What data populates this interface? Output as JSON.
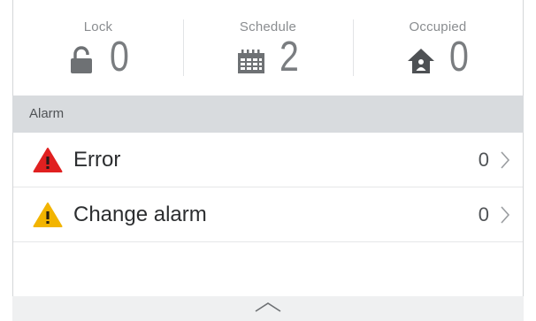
{
  "counters": [
    {
      "label": "Lock",
      "value": "0",
      "icon": "lock-icon"
    },
    {
      "label": "Schedule",
      "value": "2",
      "icon": "calendar-icon"
    },
    {
      "label": "Occupied",
      "value": "0",
      "icon": "home-occupied-icon"
    }
  ],
  "alarm_section": {
    "title": "Alarm",
    "items": [
      {
        "label": "Error",
        "count": "0",
        "icon": "error-warning-icon",
        "icon_color": "#e02020"
      },
      {
        "label": "Change alarm",
        "count": "0",
        "icon": "change-alarm-warning-icon",
        "icon_color": "#f2b400"
      }
    ]
  },
  "colors": {
    "section_header_bg": "#d8dbde",
    "error": "#e02020",
    "warning": "#f2b400",
    "counter_text": "#7a7d80"
  }
}
